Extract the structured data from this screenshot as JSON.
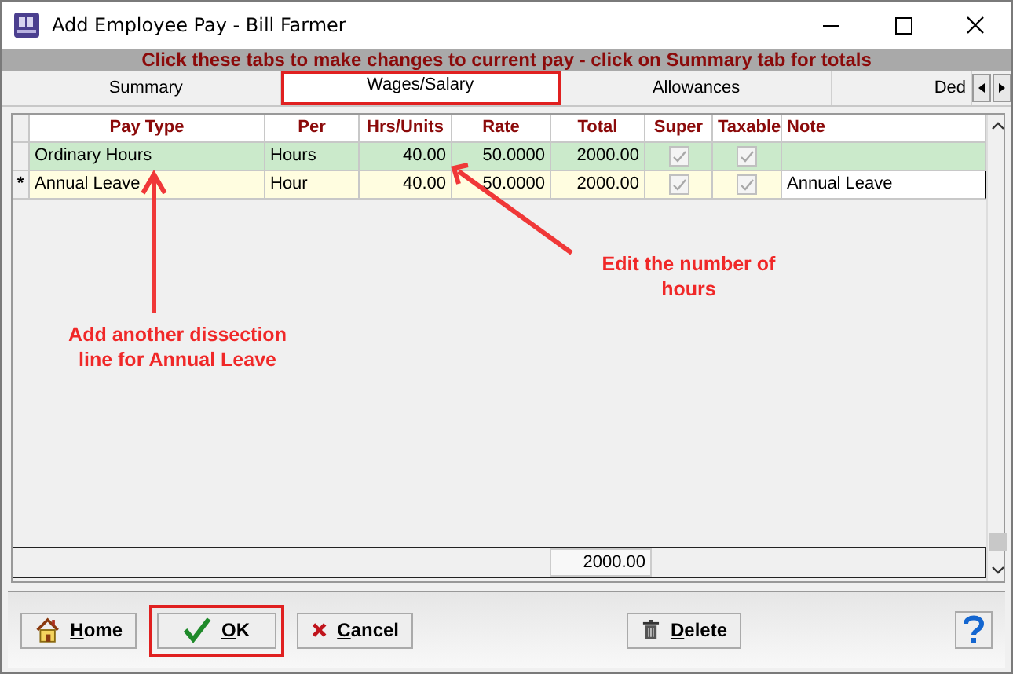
{
  "window": {
    "title": "Add Employee Pay - Bill Farmer"
  },
  "banner": "Click these tabs to make changes to current pay - click on Summary tab for totals",
  "tabs": [
    {
      "label": "Summary",
      "selected": false,
      "highlighted": false
    },
    {
      "label": "Wages/Salary",
      "selected": true,
      "highlighted": true
    },
    {
      "label": "Allowances",
      "selected": false,
      "highlighted": false
    },
    {
      "label": "Ded",
      "selected": false,
      "highlighted": false
    }
  ],
  "table": {
    "columns": [
      "Pay Type",
      "Per",
      "Hrs/Units",
      "Rate",
      "Total",
      "Super",
      "Taxable",
      "Note"
    ],
    "rows": [
      {
        "kind": "saved",
        "pay_type": "Ordinary Hours",
        "per": "Hours",
        "hrs_units": "40.00",
        "rate": "50.0000",
        "total": "2000.00",
        "super": true,
        "taxable": true
      },
      {
        "kind": "new",
        "marker": "*",
        "pay_type": "Annual Leave",
        "per": "Hour",
        "hrs_units": "40.00",
        "rate": "50.0000",
        "total": "2000.00",
        "super": true,
        "taxable": true,
        "note": "Annual Leave"
      }
    ],
    "footer_total": "2000.00"
  },
  "annotations": [
    "Add another dissection line for Annual Leave",
    "Edit the number of hours"
  ],
  "buttons": [
    {
      "kind": "home",
      "label": "Home",
      "highlighted": false
    },
    {
      "kind": "ok",
      "label": "OK",
      "highlighted": true
    },
    {
      "kind": "cancel",
      "label": "Cancel",
      "highlighted": false
    },
    {
      "kind": "delete",
      "label": "Delete",
      "highlighted": false
    },
    {
      "kind": "help",
      "highlighted": false
    }
  ]
}
